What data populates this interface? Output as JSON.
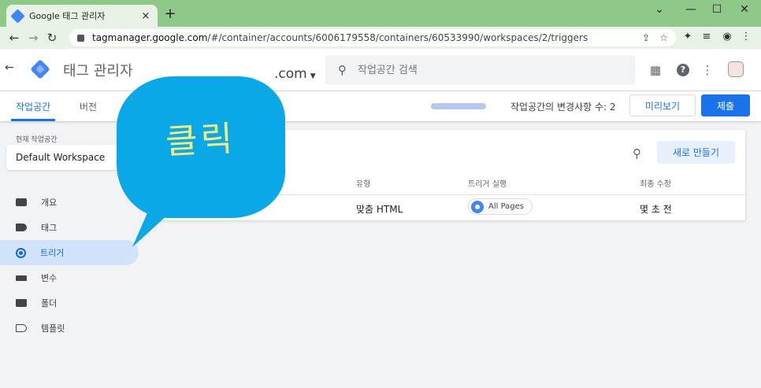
{
  "browser": {
    "tab_title": "Google 태그 관리자",
    "tab_close": "×",
    "new_tab": "+",
    "url_host": "tagmanager.google.com",
    "url_path": "/#/container/accounts/6006179558/containers/60533990/workspaces/2/triggers",
    "window_controls": [
      "⌄",
      "—",
      "☐",
      "✕"
    ]
  },
  "header": {
    "product_name": "태그 관리자",
    "account_suffix": ".com",
    "search_placeholder": "작업공간 검색"
  },
  "subnav": {
    "tabs": [
      {
        "label": "작업공간",
        "active": true
      },
      {
        "label": "버전",
        "active": false
      }
    ],
    "changes_text": "작업공간의 변경사항 수: 2",
    "preview_label": "미리보기",
    "submit_label": "제출"
  },
  "sidebar": {
    "workspace_label": "현재 작업공간",
    "workspace_name": "Default Workspace",
    "items": [
      {
        "label": "개요",
        "icon": "overview-icon"
      },
      {
        "label": "태그",
        "icon": "tag-icon"
      },
      {
        "label": "트리거",
        "icon": "trigger-icon",
        "active": true
      },
      {
        "label": "변수",
        "icon": "variable-icon"
      },
      {
        "label": "폴더",
        "icon": "folder-icon"
      },
      {
        "label": "템플릿",
        "icon": "template-icon"
      }
    ]
  },
  "triggers_table": {
    "new_button": "새로 만들기",
    "columns": [
      "유형",
      "트리거 실행",
      "최종 수정"
    ],
    "rows": [
      {
        "type": "맞춤 HTML",
        "fires_on": "All Pages",
        "last_edited": "몇 초 전"
      }
    ]
  },
  "annotation": {
    "text": "클릭",
    "bubble_color": "#0aa8e6",
    "text_color": "#f2ec7e"
  },
  "colors": {
    "accent": "#1a73e8",
    "active_nav_bg": "#d2e3fc",
    "tabbar": "#8fc98a"
  }
}
